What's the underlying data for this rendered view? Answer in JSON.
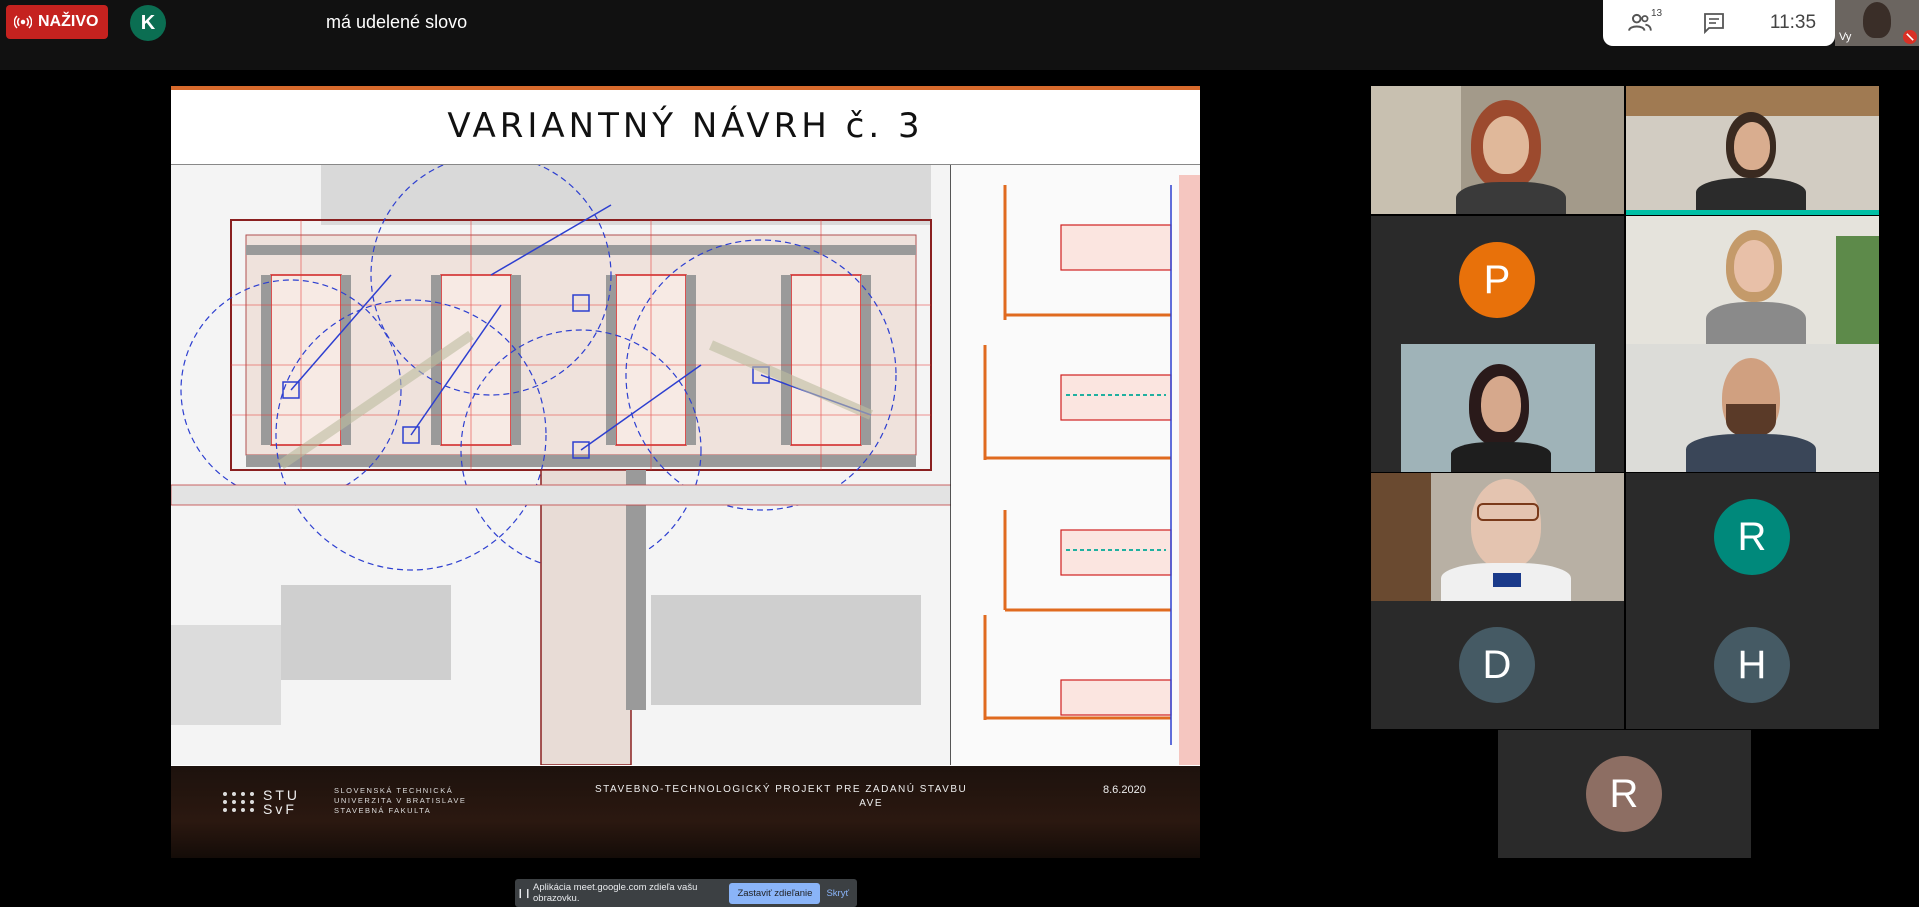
{
  "topbar": {
    "live_label": "NAŽIVO",
    "presenter_initial": "K",
    "speaker_status": "má udelené slovo",
    "participant_count": "13",
    "time": "11:35",
    "self_label": "Vy"
  },
  "slide": {
    "title": "VARIANTNÝ NÁVRH č. 3",
    "logo_text_1": "STU",
    "logo_text_2": "SvF",
    "university_line1": "SLOVENSKÁ TECHNICKÁ",
    "university_line2": "UNIVERZITA V BRATISLAVE",
    "university_line3": "STAVEBNÁ FAKULTA",
    "project_text": "STAVEBNO-TECHNOLOGICKÝ PROJEKT PRE ZADANÚ STAVBU",
    "project_text_2": "AVE",
    "date": "8.6.2020"
  },
  "share_bar": {
    "message": "Aplikácia meet.google.com zdieľa vašu obrazovku.",
    "stop_label": "Zastaviť zdieľanie",
    "hide_label": "Skryť"
  },
  "participants": [
    {
      "type": "video",
      "id": "woman-red-hair"
    },
    {
      "type": "video",
      "id": "woman-speaking"
    },
    {
      "type": "avatar",
      "initial": "P",
      "color": "#e8710a"
    },
    {
      "type": "video",
      "id": "woman-necklace"
    },
    {
      "type": "video",
      "id": "woman-headset"
    },
    {
      "type": "video",
      "id": "man-glasses-beard"
    },
    {
      "type": "video",
      "id": "man-bowtie"
    },
    {
      "type": "avatar",
      "initial": "R",
      "color": "#00897b"
    },
    {
      "type": "avatar",
      "initial": "D",
      "color": "#455a64"
    },
    {
      "type": "avatar",
      "initial": "H",
      "color": "#455a64"
    },
    {
      "type": "avatar",
      "initial": "R",
      "color": "#8d6e63"
    }
  ],
  "colors": {
    "live_red": "#c5221f",
    "active_speaker": "#00bfa5",
    "slide_accent": "#d86a2c"
  }
}
